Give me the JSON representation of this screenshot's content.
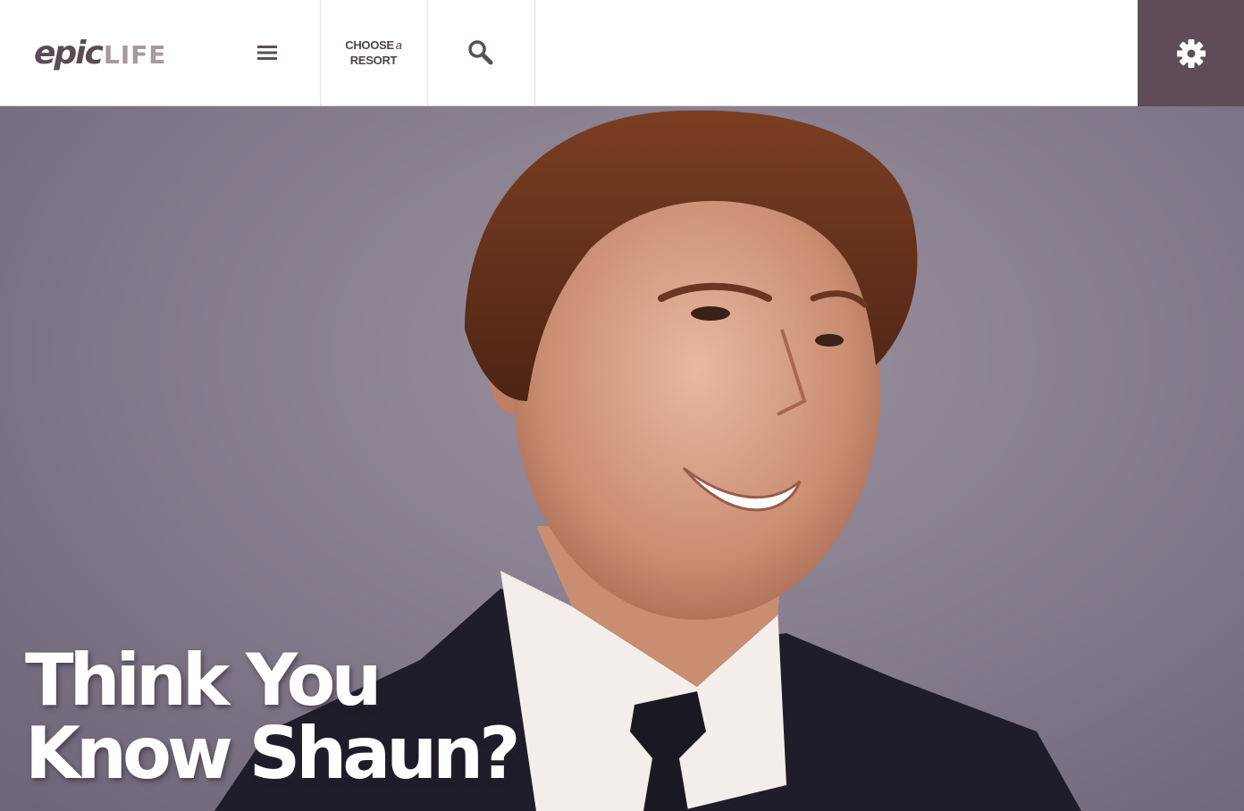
{
  "header": {
    "logo": {
      "part1": "epic",
      "part2": "LIFE"
    },
    "menu_icon": "menu-icon",
    "choose_resort": {
      "line1": "CHOOSE",
      "article": "a",
      "line2": "RESORT"
    },
    "search_icon": "search-icon",
    "settings_icon": "gear-icon"
  },
  "hero": {
    "title_line1": "Think You",
    "title_line2": "Know Shaun?"
  },
  "colors": {
    "brand": "#5f4c58",
    "logo_light": "#a8999f",
    "hero_bg": "#877e8e"
  }
}
